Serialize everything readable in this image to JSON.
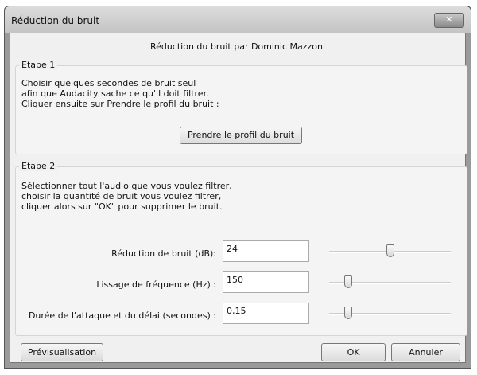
{
  "window": {
    "title": "Réduction du bruit",
    "close_icon": "close-icon"
  },
  "subtitle": "Réduction du bruit par Dominic Mazzoni",
  "step1": {
    "label": "Etape 1",
    "lines": [
      "Choisir quelques secondes de bruit seul",
      "afin que Audacity sache ce qu'il doit filtrer.",
      "Cliquer ensuite sur Prendre le profil du bruit :"
    ],
    "button": "Prendre le profil du bruit"
  },
  "step2": {
    "label": "Etape 2",
    "lines": [
      "Sélectionner tout l'audio que vous voulez filtrer,",
      "choisir la quantité de bruit vous voulez filtrer,",
      "cliquer alors sur \"OK\" pour supprimer le bruit."
    ],
    "rows": [
      {
        "label": "Réduction de bruit (dB):",
        "value": "24",
        "slider": 0.5
      },
      {
        "label": "Lissage de fréquence (Hz) :",
        "value": "150",
        "slider": 0.16
      },
      {
        "label": "Durée de l'attaque et du délai (secondes) :",
        "value": "0,15",
        "slider": 0.16
      }
    ]
  },
  "buttons": {
    "preview": "Prévisualisation",
    "ok": "OK",
    "cancel": "Annuler"
  }
}
